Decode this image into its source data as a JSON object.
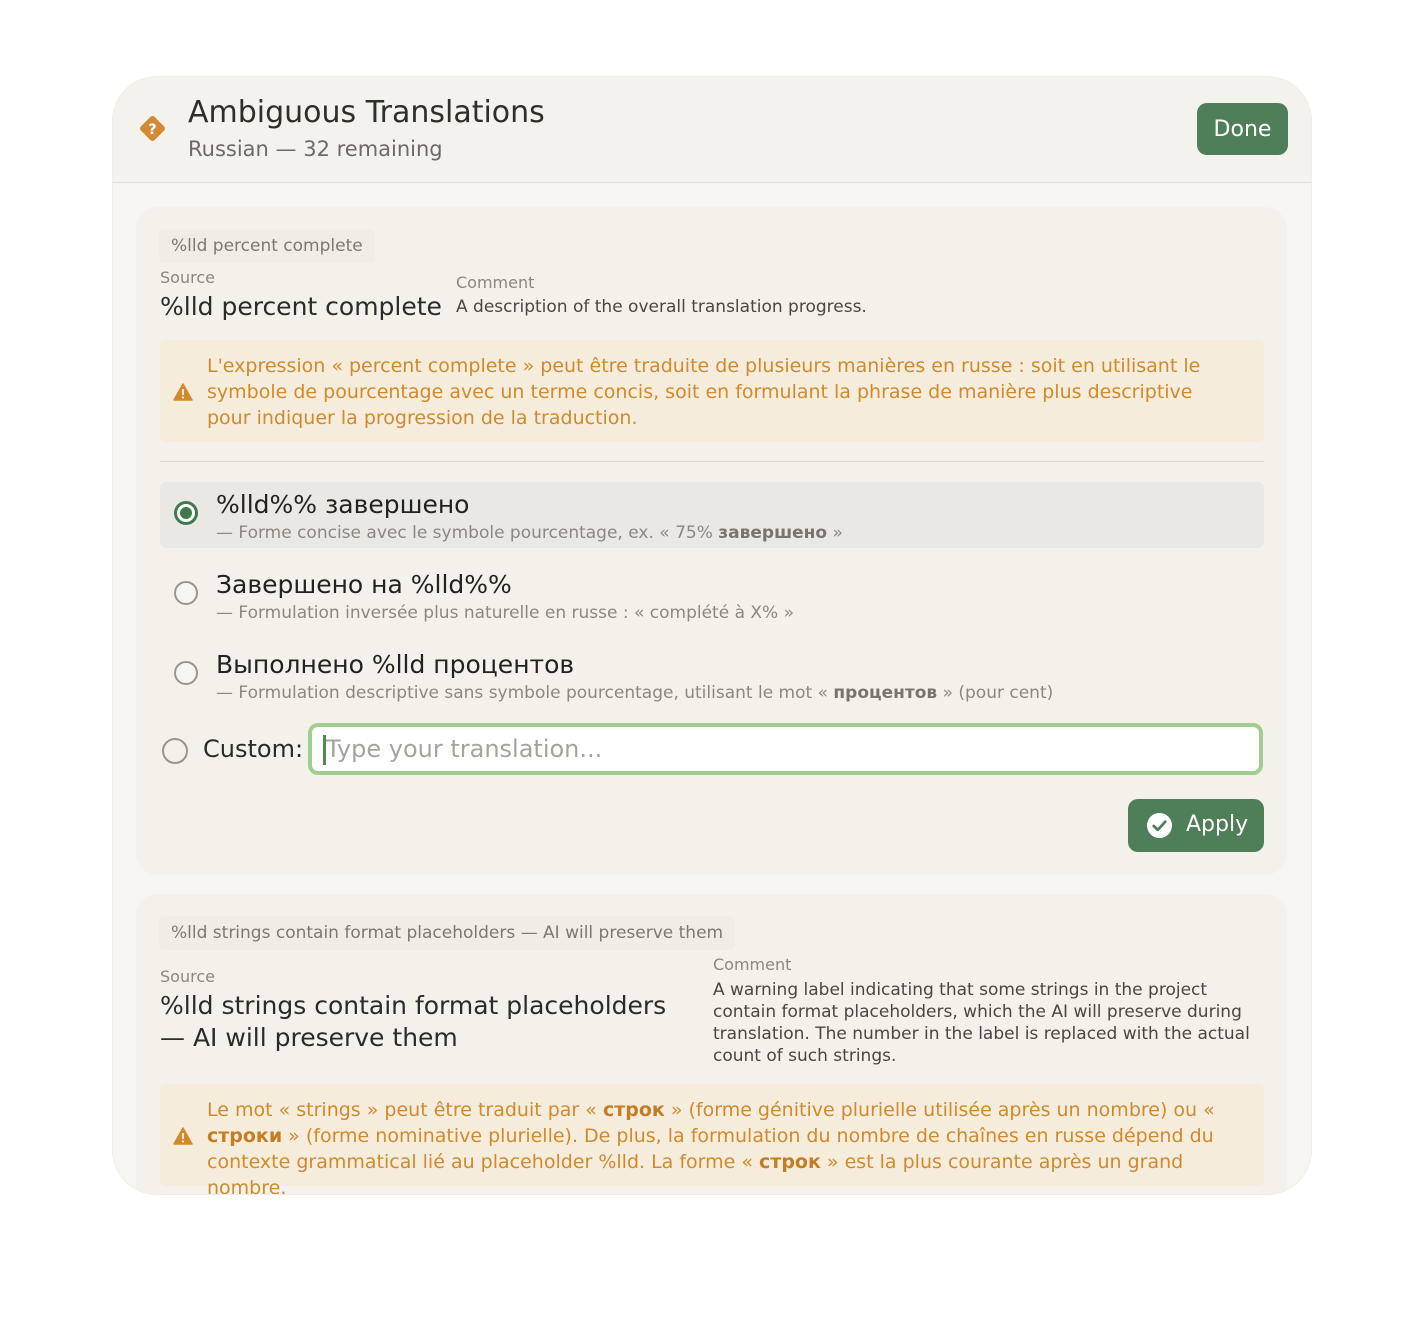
{
  "header": {
    "title": "Ambiguous Translations",
    "subtitle": "Russian — 32 remaining",
    "done_label": "Done",
    "icon": "question-diamond-icon"
  },
  "colors": {
    "accent": "#4f7f58",
    "warning": "#d08a2c",
    "input_focus": "#9fce8e"
  },
  "card1": {
    "tag": "%lld percent complete",
    "source_label": "Source",
    "source": "%lld percent complete",
    "comment_label": "Comment",
    "comment": "A description of the overall translation progress.",
    "warning": {
      "line1": "L'expression « percent complete » peut être traduite de plusieurs manières en russe : soit en utilisant le symbole de pourcentage avec un terme concis, soit en formulant la phrase de manière plus descriptive pour indiquer la progression de la traduction."
    },
    "options": [
      {
        "main": "%lld%% завершено",
        "desc_prefix": "— Forme concise avec le symbole pourcentage, ex. « 75% ",
        "desc_bold": "завершено",
        "desc_suffix": " »",
        "selected": true
      },
      {
        "main": "Завершено на %lld%%",
        "desc_prefix": "— Formulation inversée plus naturelle en russe : « complété à X% »",
        "desc_bold": "",
        "desc_suffix": "",
        "selected": false
      },
      {
        "main": "Выполнено %lld процентов",
        "desc_prefix": "— Formulation descriptive sans symbole pourcentage, utilisant le mot « ",
        "desc_bold": "процентов",
        "desc_suffix": " » (pour cent)",
        "selected": false
      }
    ],
    "custom_label": "Custom:",
    "custom_placeholder": "Type your translation...",
    "apply_label": "Apply"
  },
  "card2": {
    "tag": "%lld strings contain format placeholders — AI will preserve them",
    "source_label": "Source",
    "source": "%lld strings contain format placeholders — AI will preserve them",
    "comment_label": "Comment",
    "comment": "A warning label indicating that some strings in the project contain format placeholders, which the AI will preserve during translation. The number in the label is replaced with the actual count of such strings.",
    "warning": {
      "p1": "Le mot « strings » peut être traduit par « ",
      "b1": "строк",
      "p2": " » (forme génitive plurielle utilisée après un nombre) ou « ",
      "b2": "строки",
      "p3": " » (forme nominative plurielle). De plus, la formulation du nombre de chaînes en russe dépend du contexte grammatical lié au placeholder %lld. La forme « ",
      "b3": "строк",
      "p4": " » est la plus courante après un grand nombre."
    }
  }
}
